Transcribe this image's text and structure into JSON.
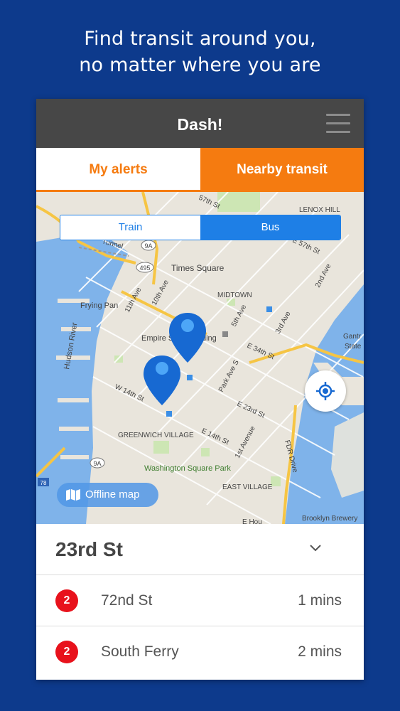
{
  "promo": {
    "line1": "Find transit around you,",
    "line2": "no matter where you are"
  },
  "app": {
    "title": "Dash!",
    "menu_icon": "hamburger-menu-icon"
  },
  "tabs": [
    {
      "label": "My alerts",
      "active": true
    },
    {
      "label": "Nearby transit",
      "active": false
    }
  ],
  "mode_toggle": {
    "options": [
      "Train",
      "Bus"
    ],
    "selected": "Bus"
  },
  "map": {
    "labels": {
      "lenox_hill": "LENOX HILL",
      "times_square": "Times Square",
      "midtown": "MIDTOWN",
      "frying_pan": "Frying Pan",
      "empire_state": "Empire State Building",
      "hudson_river": "Hudson River",
      "greenwich_village": "GREENWICH VILLAGE",
      "washington_square": "Washington Square Park",
      "east_village": "EAST VILLAGE",
      "brooklyn_brewery": "Brooklyn Brewery",
      "fdr_drive": "FDR Drive",
      "e34": "E 34th St",
      "e23": "E 23rd St",
      "e14": "E 14th St",
      "w14": "W 14th St",
      "e57": "E 57th St",
      "st57": "57th St",
      "ave11": "11th Ave",
      "ave10": "10th Ave",
      "ave5": "5th Ave",
      "ave3": "3rd Ave",
      "ave2": "2nd Ave",
      "park_ave": "Park Ave S",
      "first_ave": "1st Avenue",
      "tunnel": "Tunnel",
      "rt9a": "9A",
      "rt495": "495",
      "rt78": "78",
      "ehou": "E Hou",
      "gantry": "Gantr",
      "gantry2": "State"
    },
    "locate_icon": "my-location-icon",
    "pin_icon": "map-pin-icon",
    "offline_label": "Offline map",
    "offline_icon": "map-book-icon"
  },
  "station": {
    "name": "23rd St",
    "chevron_icon": "chevron-down-icon",
    "arrivals": [
      {
        "route": "2",
        "destination": "72nd St",
        "eta": "1 mins"
      },
      {
        "route": "2",
        "destination": "South Ferry",
        "eta": "2 mins"
      }
    ]
  },
  "colors": {
    "background": "#0d3a8c",
    "accent_orange": "#f57b10",
    "toggle_blue": "#1e7fe6",
    "route_red": "#e8121c",
    "appbar": "#474747"
  }
}
